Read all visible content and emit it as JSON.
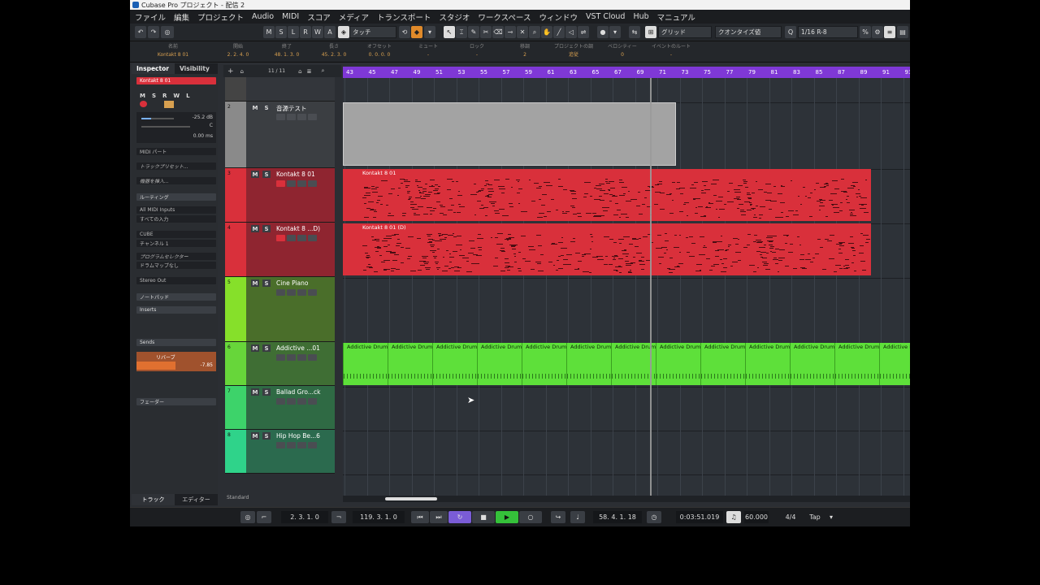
{
  "window": {
    "title": "Cubase Pro プロジェクト - 配信 2"
  },
  "menu": [
    "ファイル",
    "編集",
    "プロジェクト",
    "Audio",
    "MIDI",
    "スコア",
    "メディア",
    "トランスポート",
    "スタジオ",
    "ワークスペース",
    "ウィンドウ",
    "VST Cloud",
    "Hub",
    "マニュアル"
  ],
  "toolbar": {
    "m": "M",
    "s": "S",
    "l": "L",
    "r": "R",
    "w": "W",
    "a": "A",
    "automation_mode": "タッチ",
    "snap_type": "グリッド",
    "quantize_type": "クオンタイズ値",
    "quantize": "1/16 R-8"
  },
  "infoline": {
    "name_label": "名前",
    "name_value": "Kontakt 8 01",
    "start_label": "開始",
    "start_value": "2. 2. 4. 0",
    "end_label": "終了",
    "end_value": "48. 1. 3. 0",
    "length_label": "長さ",
    "length_value": "45. 2. 3. 0",
    "offset_label": "オフセット",
    "offset_value": "0. 0. 0. 0",
    "mute_label": "ミュート",
    "mute_value": "-",
    "lock_label": "ロック",
    "lock_value": "-",
    "transpose_label": "移調",
    "transpose_value": "2",
    "key_label": "プロジェクトの調",
    "key_value": "追従",
    "velocity_label": "ベロシティー",
    "velocity_value": "0",
    "route_label": "イベントのルート",
    "route_value": "-"
  },
  "inspector": {
    "tab_inspector": "Inspector",
    "tab_visibility": "Visibility",
    "track_name": "Kontakt 8 01",
    "volume": "-25.2 dB",
    "pan": "C",
    "delay": "0.00 ms",
    "midi_part": "MIDI パート",
    "track_preset": "トラックプリセット...",
    "insert_hint": "機器を挿入...",
    "routing": "ルーティング",
    "midi_input": "All MIDI Inputs",
    "input_channel": "すべての入力",
    "output": "CUBE",
    "channel": "チャンネル 1",
    "program": "プログラムセレクター",
    "drummap": "ドラムマップなし",
    "audio_out": "Stereo Out",
    "notepad": "ノートパッド",
    "inserts": "Inserts",
    "sends": "Sends",
    "send_name": "リバーブ",
    "send_level": "-7.85",
    "fader": "フェーダー",
    "bottom_track": "トラック",
    "bottom_editor": "エディター"
  },
  "trackarea": {
    "count": "11 / 11",
    "preset": "Standard"
  },
  "tracks": [
    {
      "num": "2",
      "name": "音源テスト",
      "color": "#8a8a8a"
    },
    {
      "num": "3",
      "name": "Kontakt 8 01",
      "color": "#d9303b"
    },
    {
      "num": "4",
      "name": "Kontakt 8 ...D)",
      "color": "#d9303b"
    },
    {
      "num": "5",
      "name": "Cine Piano",
      "color": "#86e02a"
    },
    {
      "num": "6",
      "name": "Addictive ...01",
      "color": "#67d63a"
    },
    {
      "num": "7",
      "name": "Ballad Gro...ck",
      "color": "#3dd36a"
    },
    {
      "num": "8",
      "name": "Hip Hop Be...6",
      "color": "#2fd38a"
    }
  ],
  "ruler": [
    "43",
    "45",
    "47",
    "49",
    "51",
    "53",
    "55",
    "57",
    "59",
    "61",
    "63",
    "65",
    "67",
    "69",
    "71",
    "73",
    "75",
    "77",
    "79",
    "81",
    "83",
    "85",
    "87",
    "89",
    "91",
    "93"
  ],
  "parts": {
    "kontakt": "Kontakt 8 01",
    "kontakt_d": "Kontakt 8 01 (D)",
    "drums": "Addictive Drums"
  },
  "transport": {
    "left_locator": "2. 3. 1. 0",
    "right_locator": "119. 3. 1. 0",
    "position_bars": "58. 4. 1. 18",
    "position_time": "0:03:51.019",
    "tempo": "60.000",
    "signature": "4/4",
    "tap": "Tap"
  }
}
